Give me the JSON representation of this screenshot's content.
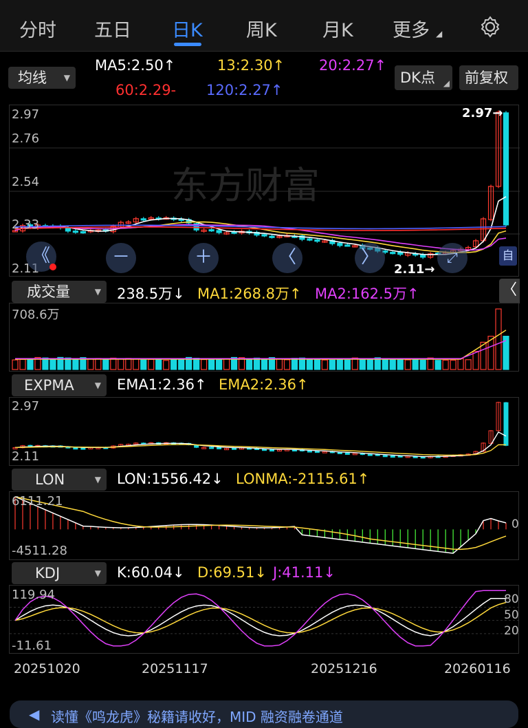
{
  "tabs": [
    {
      "label": "分时",
      "active": false
    },
    {
      "label": "五日",
      "active": false
    },
    {
      "label": "日K",
      "active": true
    },
    {
      "label": "周K",
      "active": false
    },
    {
      "label": "月K",
      "active": false
    },
    {
      "label": "更多",
      "active": false
    }
  ],
  "settings_icon": "gear-icon",
  "main": {
    "selector_label": "均线",
    "ma5": "MA5:2.50↑",
    "ma13": "13:2.30↑",
    "ma20": "20:2.27↑",
    "ma60": "60:2.29-",
    "ma120": "120:2.27↑",
    "dk_button": "DK点",
    "adjust_button": "前复权",
    "axis": [
      "2.97",
      "2.76",
      "2.54",
      "2.33",
      "2.11"
    ],
    "high_marker": "2.97→",
    "low_marker": "2.11→",
    "watermark": "东方财富",
    "nav_buttons": [
      "《",
      "－",
      "＋",
      "〈",
      "〉"
    ],
    "self_label": "自"
  },
  "volume": {
    "selector_label": "成交量",
    "vol": "238.5万↓",
    "ma1": "MA1:268.8万↑",
    "ma2": "MA2:162.5万↑",
    "axis_top": "708.6万"
  },
  "expma": {
    "selector_label": "EXPMA",
    "ema1": "EMA1:2.36↑",
    "ema2": "EMA2:2.36↑",
    "axis": [
      "2.97",
      "2.11"
    ]
  },
  "lon": {
    "selector_label": "LON",
    "lon": "LON:1556.42↓",
    "lonma": "LONMA:-2115.61↑",
    "axis": [
      "6111.21",
      "-4511.28"
    ],
    "zero": "0"
  },
  "kdj": {
    "selector_label": "KDJ",
    "k": "K:60.04↓",
    "d": "D:69.51↓",
    "j": "J:41.11↓",
    "axis": [
      "119.94",
      "-11.61"
    ],
    "right_axis": [
      "80",
      "50",
      "20"
    ]
  },
  "dates": [
    "20251020",
    "20251117",
    "20251216",
    "20260116"
  ],
  "collapse_icon": "chevron-left-icon",
  "colors": {
    "up": "#ff3b30",
    "down": "#18d6e0",
    "ma5": "#ffffff",
    "ma13": "#ffd93b",
    "ma20": "#e040fb",
    "ma60": "#ff3030",
    "ma120": "#5060ff",
    "accent": "#3b8bff"
  },
  "banner_text": "读懂《鸣龙虎》秘籍请收好，MID 融资融卷通道"
}
